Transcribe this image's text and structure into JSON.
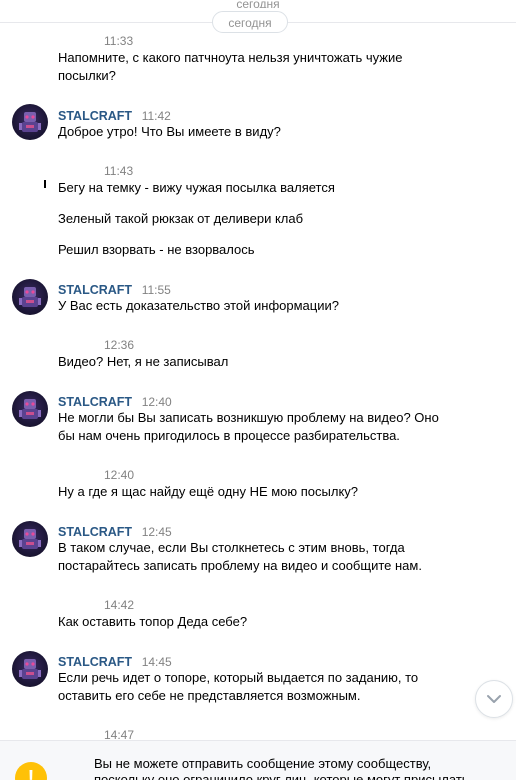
{
  "top_cut_text": "сегодня",
  "date_label": "сегодня",
  "messages": [
    {
      "type": "user",
      "time": "11:33",
      "lines": [
        "Напомните, с какого патчноута нельзя уничтожать чужие",
        "посылки?"
      ]
    },
    {
      "type": "community",
      "sender": "STALCRAFT",
      "time": "11:42",
      "lines": [
        "Доброе утро! Что Вы имеете в виду?"
      ]
    },
    {
      "type": "user",
      "time": "11:43",
      "lines": [
        "Бегу на темку - вижу чужая посылка валяется",
        "Зеленый такой рюкзак от деливери клаб",
        "Решил взорвать - не взорвалось"
      ]
    },
    {
      "type": "community",
      "sender": "STALCRAFT",
      "time": "11:55",
      "lines": [
        "У Вас есть доказательство этой информации?"
      ]
    },
    {
      "type": "user",
      "time": "12:36",
      "lines": [
        "Видео? Нет, я не записывал"
      ]
    },
    {
      "type": "community",
      "sender": "STALCRAFT",
      "time": "12:40",
      "lines": [
        "Не могли бы Вы записать возникшую проблему на видео? Оно",
        "бы нам очень пригодилось в процессе разбирательства."
      ]
    },
    {
      "type": "user",
      "time": "12:40",
      "lines": [
        "Ну а где я щас найду ещё одну НЕ мою посылку?"
      ]
    },
    {
      "type": "community",
      "sender": "STALCRAFT",
      "time": "12:45",
      "lines": [
        "В таком случае, если Вы столкнетесь с этим вновь, тогда",
        "постарайтесь записать проблему на видео и сообщите нам."
      ]
    },
    {
      "type": "user",
      "time": "14:42",
      "lines": [
        "Как оставить топор Деда себе?"
      ]
    },
    {
      "type": "community",
      "sender": "STALCRAFT",
      "time": "14:45",
      "lines": [
        "Если речь идет о топоре, который выдается по заданию, то",
        "оставить его себе не представляется возможным."
      ]
    },
    {
      "type": "user",
      "time": "14:47",
      "lines": []
    }
  ],
  "footer": {
    "line1": "Вы не можете отправить сообщение этому сообществу,",
    "line2": "поскольку оно ограничило круг лиц, которые могут присылать",
    "icon": "!"
  },
  "colors": {
    "sender": "#2a5885",
    "time": "#828282",
    "warning": "#ffc107"
  }
}
